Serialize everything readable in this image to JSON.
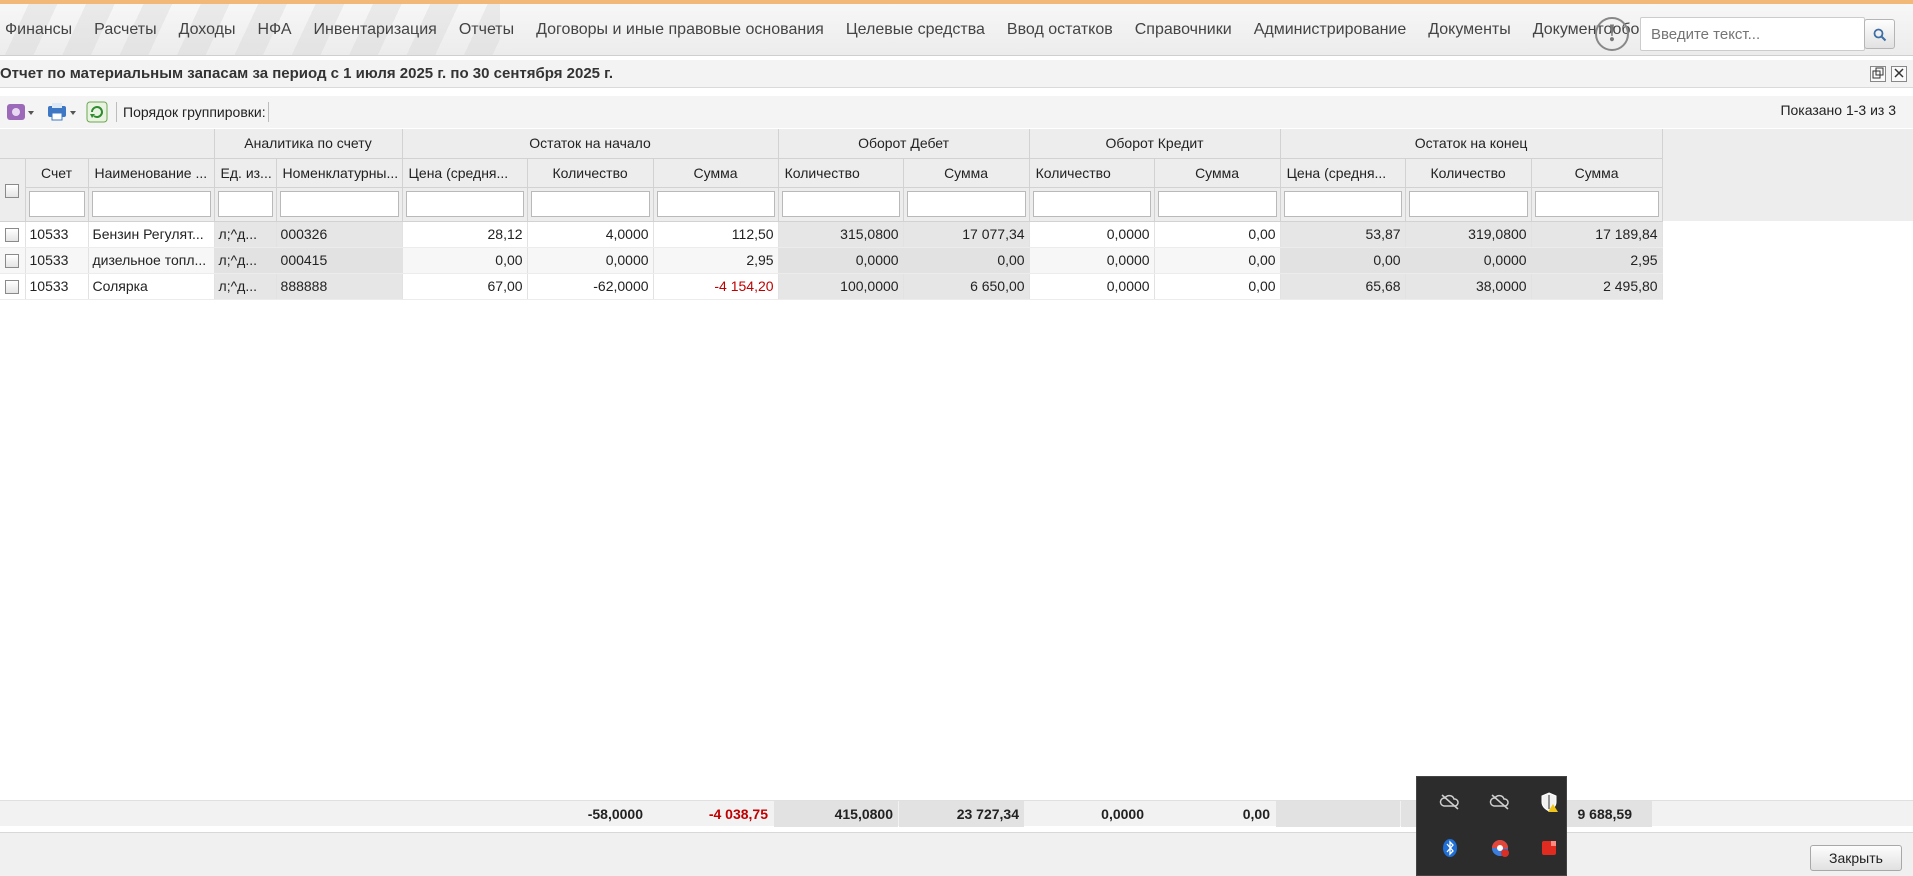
{
  "menu": {
    "items": [
      "Финансы",
      "Расчеты",
      "Доходы",
      "НФА",
      "Инвентаризация",
      "Отчеты",
      "Договоры и иные правовые основания",
      "Целевые средства",
      "Ввод остатков",
      "Справочники",
      "Администрирование",
      "Документы",
      "Документооборот"
    ],
    "alert_glyph": "!",
    "search_placeholder": "Введите текст..."
  },
  "window": {
    "title": "Отчет по материальным запасам за период с 1 июля 2025 г. по 30 сентября 2025 г."
  },
  "toolbar": {
    "grouping_label": "Порядок группировки:",
    "shown_text": "Показано 1-3 из 3"
  },
  "grid": {
    "group_headers": [
      "Аналитика по счету",
      "Остаток на начало",
      "Оборот Дебет",
      "Оборот Кредит",
      "Остаток на конец"
    ],
    "columns": [
      "Счет",
      "Наименование ...",
      "Ед. из...",
      "Номенклатурны...",
      "Цена (средня...",
      "Количество",
      "Сумма",
      "Количество",
      "Сумма",
      "Количество",
      "Сумма",
      "Цена (средня...",
      "Количество",
      "Сумма"
    ],
    "rows": [
      [
        "10533",
        "Бензин Регулят...",
        "л;^д...",
        "000326",
        "28,12",
        "4,0000",
        "112,50",
        "315,0800",
        "17 077,34",
        "0,0000",
        "0,00",
        "53,87",
        "319,0800",
        "17 189,84"
      ],
      [
        "10533",
        "дизельное топл...",
        "л;^д...",
        "000415",
        "0,00",
        "0,0000",
        "2,95",
        "0,0000",
        "0,00",
        "0,0000",
        "0,00",
        "0,00",
        "0,0000",
        "2,95"
      ],
      [
        "10533",
        "Солярка",
        "л;^д...",
        "888888",
        "67,00",
        "-62,0000",
        "-4 154,20",
        "100,0000",
        "6 650,00",
        "0,0000",
        "0,00",
        "65,68",
        "38,0000",
        "2 495,80"
      ]
    ],
    "negative_color": "#c00000"
  },
  "totals": {
    "start_qty": "-58,0000",
    "start_sum": "-4 038,75",
    "debit_qty": "415,0800",
    "debit_sum": "23 727,34",
    "credit_qty": "0,0000",
    "credit_sum": "0,00",
    "end_sum_partial": "9 688,59"
  },
  "buttons": {
    "close_label": "Закрыть"
  },
  "tray": {
    "icons": [
      "cloud-off-icon",
      "cloud-off-icon",
      "shield-warning-icon",
      "bluetooth-icon",
      "browser-update-icon",
      "red-app-icon"
    ]
  }
}
